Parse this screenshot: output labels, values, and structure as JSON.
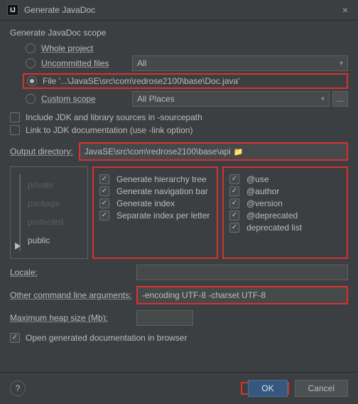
{
  "titlebar": {
    "icon": "IJ",
    "title": "Generate JavaDoc",
    "close": "×"
  },
  "scope": {
    "heading": "Generate JavaDoc scope",
    "whole": "Whole project",
    "uncommitted": "Uncommitted files",
    "uncommitted_val": "All",
    "file": "File '...\\JavaSE\\src\\com\\redrose2100\\base\\Doc.java'",
    "custom": "Custom scope",
    "custom_val": "All Places",
    "ellipsis": "..."
  },
  "includes": {
    "jdk": "Include JDK and library sources in -sourcepath",
    "link": "Link to JDK documentation (use -link option)"
  },
  "output": {
    "label": "Output directory:",
    "value": "JavaSE\\src\\com\\redrose2100\\base\\api"
  },
  "visibility": {
    "private": "private",
    "package": "package",
    "protected": "protected",
    "public": "public"
  },
  "gen": {
    "hierarchy": "Generate hierarchy tree",
    "nav": "Generate navigation bar",
    "index": "Generate index",
    "sep": "Separate index per letter"
  },
  "tags": {
    "use": "@use",
    "author": "@author",
    "version": "@version",
    "deprecated": "@deprecated",
    "deplist": "deprecated list"
  },
  "locale": {
    "label": "Locale:"
  },
  "args": {
    "label": "Other command line arguments:",
    "value": "-encoding UTF-8 -charset UTF-8"
  },
  "heap": {
    "label": "Maximum heap size (Mb):"
  },
  "open": {
    "label": "Open generated documentation in browser"
  },
  "buttons": {
    "help": "?",
    "ok": "OK",
    "cancel": "Cancel"
  }
}
